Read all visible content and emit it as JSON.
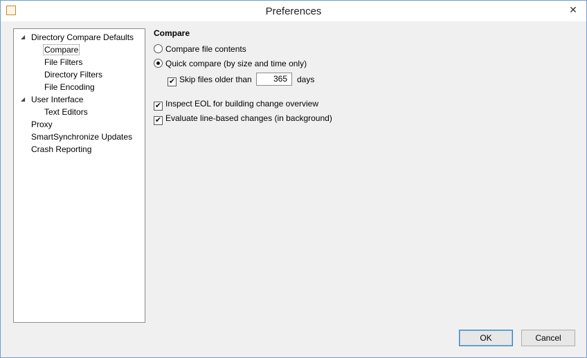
{
  "window": {
    "title": "Preferences",
    "close_symbol": "✕",
    "app_icon": "smartsynchronize-icon"
  },
  "tree": {
    "items": [
      {
        "label": "Directory Compare Defaults",
        "level": 0,
        "expanded": true
      },
      {
        "label": "Compare",
        "level": 1,
        "selected": true
      },
      {
        "label": "File Filters",
        "level": 1
      },
      {
        "label": "Directory Filters",
        "level": 1
      },
      {
        "label": "File Encoding",
        "level": 1
      },
      {
        "label": "User Interface",
        "level": 0,
        "expanded": true
      },
      {
        "label": "Text Editors",
        "level": 1
      },
      {
        "label": "Proxy",
        "level": 0
      },
      {
        "label": "SmartSynchronize Updates",
        "level": 0
      },
      {
        "label": "Crash Reporting",
        "level": 0
      }
    ],
    "expander_symbol": "◢"
  },
  "compare": {
    "section_title": "Compare",
    "compare_file_contents": {
      "label": "Compare file contents",
      "checked": false
    },
    "quick_compare": {
      "label": "Quick compare (by size and time only)",
      "checked": true
    },
    "skip_files": {
      "label": "Skip files older than",
      "checked": true,
      "value": "365",
      "unit": "days"
    },
    "inspect_eol": {
      "label": "Inspect EOL for building change overview",
      "checked": true
    },
    "evaluate_line": {
      "label": "Evaluate line-based changes (in background)",
      "checked": true
    },
    "check_mark": "✔"
  },
  "buttons": {
    "ok": "OK",
    "cancel": "Cancel"
  }
}
